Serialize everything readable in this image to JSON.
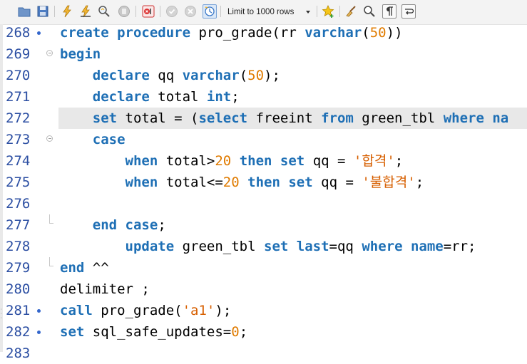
{
  "toolbar": {
    "limit_label": "Limit to 1000 rows",
    "icons": [
      "folder-open-icon",
      "save-icon",
      "execute-icon",
      "execute-current-icon",
      "explain-icon",
      "stop-icon",
      "toggle-error-icon",
      "commit-icon",
      "rollback-icon",
      "autocommit-icon",
      "limit-rows-select",
      "bookmark-star-icon",
      "beautify-icon",
      "find-icon",
      "invisible-chars-icon",
      "wrap-icon"
    ]
  },
  "editor": {
    "colors": {
      "keyword": "#1e6fb5",
      "number": "#e07b00",
      "string": "#d75f00",
      "line_number": "#2b4ea2",
      "current_line": "#e8e8e8"
    },
    "lines": [
      {
        "num": "268",
        "marker": true,
        "fold": "",
        "tokens": [
          {
            "t": "create",
            "c": "kw"
          },
          {
            "t": " "
          },
          {
            "t": "procedure",
            "c": "kw"
          },
          {
            "t": " pro_grade(rr "
          },
          {
            "t": "varchar",
            "c": "kw"
          },
          {
            "t": "("
          },
          {
            "t": "50",
            "c": "num"
          },
          {
            "t": "))"
          }
        ]
      },
      {
        "num": "269",
        "marker": false,
        "fold": "open",
        "tokens": [
          {
            "t": "begin",
            "c": "kw"
          }
        ]
      },
      {
        "num": "270",
        "marker": false,
        "fold": "",
        "tokens": [
          {
            "t": "    "
          },
          {
            "t": "declare",
            "c": "kw"
          },
          {
            "t": " qq "
          },
          {
            "t": "varchar",
            "c": "kw"
          },
          {
            "t": "("
          },
          {
            "t": "50",
            "c": "num"
          },
          {
            "t": ");"
          }
        ]
      },
      {
        "num": "271",
        "marker": false,
        "fold": "",
        "tokens": [
          {
            "t": "    "
          },
          {
            "t": "declare",
            "c": "kw"
          },
          {
            "t": " total "
          },
          {
            "t": "int",
            "c": "kw"
          },
          {
            "t": ";"
          }
        ]
      },
      {
        "num": "272",
        "marker": false,
        "fold": "",
        "highlight": true,
        "tokens": [
          {
            "t": "    "
          },
          {
            "t": "set",
            "c": "kw"
          },
          {
            "t": " total = ("
          },
          {
            "t": "select",
            "c": "kw"
          },
          {
            "t": " freeint "
          },
          {
            "t": "from",
            "c": "kw"
          },
          {
            "t": " green_tbl "
          },
          {
            "t": "where",
            "c": "kw"
          },
          {
            "t": " "
          },
          {
            "t": "na",
            "c": "kw"
          }
        ]
      },
      {
        "num": "273",
        "marker": false,
        "fold": "open",
        "tokens": [
          {
            "t": "    "
          },
          {
            "t": "case",
            "c": "kw"
          }
        ]
      },
      {
        "num": "274",
        "marker": false,
        "fold": "",
        "tokens": [
          {
            "t": "        "
          },
          {
            "t": "when",
            "c": "kw"
          },
          {
            "t": " total>"
          },
          {
            "t": "20",
            "c": "num"
          },
          {
            "t": " "
          },
          {
            "t": "then",
            "c": "kw"
          },
          {
            "t": " "
          },
          {
            "t": "set",
            "c": "kw"
          },
          {
            "t": " qq = "
          },
          {
            "t": "'",
            "c": "str"
          },
          {
            "t": "합격",
            "c": "str ko"
          },
          {
            "t": "'",
            "c": "str"
          },
          {
            "t": ";"
          }
        ]
      },
      {
        "num": "275",
        "marker": false,
        "fold": "",
        "tokens": [
          {
            "t": "        "
          },
          {
            "t": "when",
            "c": "kw"
          },
          {
            "t": " total<="
          },
          {
            "t": "20",
            "c": "num"
          },
          {
            "t": " "
          },
          {
            "t": "then",
            "c": "kw"
          },
          {
            "t": " "
          },
          {
            "t": "set",
            "c": "kw"
          },
          {
            "t": " qq = "
          },
          {
            "t": "'",
            "c": "str"
          },
          {
            "t": "불합격",
            "c": "str ko"
          },
          {
            "t": "'",
            "c": "str"
          },
          {
            "t": ";"
          }
        ]
      },
      {
        "num": "276",
        "marker": false,
        "fold": "",
        "tokens": []
      },
      {
        "num": "277",
        "marker": false,
        "fold": "end",
        "tokens": [
          {
            "t": "    "
          },
          {
            "t": "end",
            "c": "kw"
          },
          {
            "t": " "
          },
          {
            "t": "case",
            "c": "kw"
          },
          {
            "t": ";"
          }
        ]
      },
      {
        "num": "278",
        "marker": false,
        "fold": "",
        "tokens": [
          {
            "t": "        "
          },
          {
            "t": "update",
            "c": "kw"
          },
          {
            "t": " green_tbl "
          },
          {
            "t": "set",
            "c": "kw"
          },
          {
            "t": " "
          },
          {
            "t": "last",
            "c": "kw"
          },
          {
            "t": "=qq "
          },
          {
            "t": "where",
            "c": "kw"
          },
          {
            "t": " "
          },
          {
            "t": "name",
            "c": "kw"
          },
          {
            "t": "=rr;"
          }
        ]
      },
      {
        "num": "279",
        "marker": false,
        "fold": "end",
        "tokens": [
          {
            "t": "end",
            "c": "kw"
          },
          {
            "t": " ^^"
          }
        ]
      },
      {
        "num": "280",
        "marker": false,
        "fold": "",
        "tokens": [
          {
            "t": "delimiter ;"
          }
        ]
      },
      {
        "num": "281",
        "marker": true,
        "fold": "",
        "tokens": [
          {
            "t": "call",
            "c": "kw"
          },
          {
            "t": " pro_grade("
          },
          {
            "t": "'a1'",
            "c": "str"
          },
          {
            "t": ");"
          }
        ]
      },
      {
        "num": "282",
        "marker": true,
        "fold": "",
        "tokens": [
          {
            "t": "set",
            "c": "kw"
          },
          {
            "t": " sql_safe_updates="
          },
          {
            "t": "0",
            "c": "num"
          },
          {
            "t": ";"
          }
        ]
      },
      {
        "num": "283",
        "marker": false,
        "fold": "",
        "tokens": []
      }
    ]
  }
}
